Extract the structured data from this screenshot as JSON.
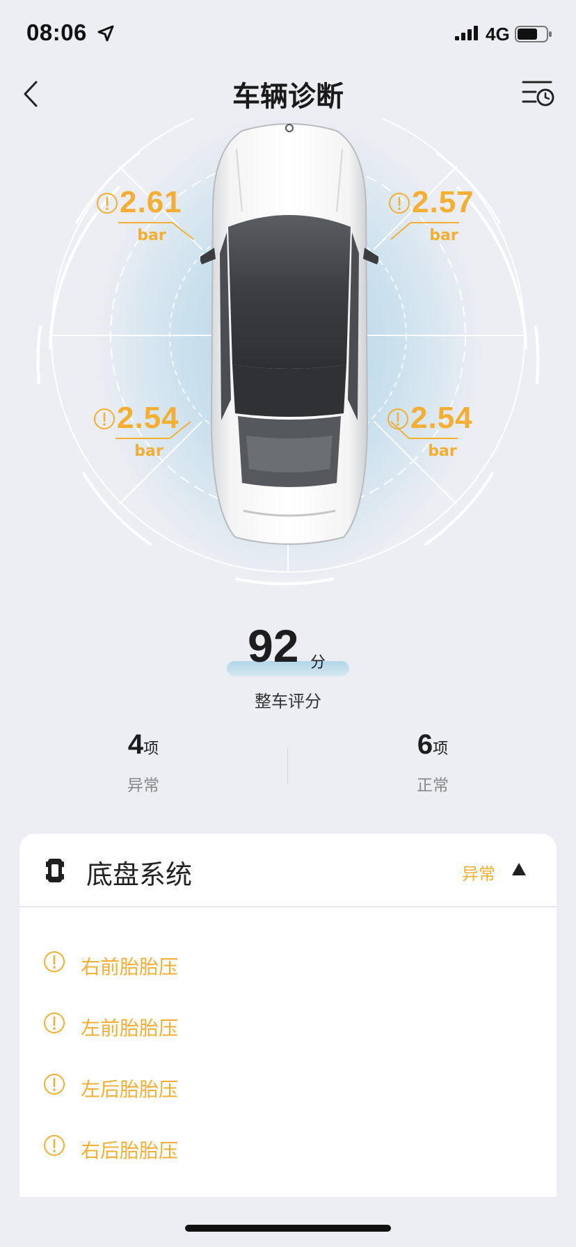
{
  "status_bar": {
    "time": "08:06",
    "network": "4G",
    "icons": [
      "location-arrow-icon",
      "signal-icon",
      "battery-icon"
    ]
  },
  "header": {
    "title": "车辆诊断",
    "icons": [
      "back-chevron-icon",
      "history-list-icon"
    ]
  },
  "tires": {
    "front_left": {
      "value": "2.61",
      "unit": "bar"
    },
    "front_right": {
      "value": "2.57",
      "unit": "bar"
    },
    "rear_left": {
      "value": "2.54",
      "unit": "bar"
    },
    "rear_right": {
      "value": "2.54",
      "unit": "bar"
    }
  },
  "score": {
    "value": "92",
    "unit": "分",
    "label": "整车评分"
  },
  "stats": {
    "abnormal": {
      "count": "4",
      "unit": "项",
      "label": "异常"
    },
    "normal": {
      "count": "6",
      "unit": "项",
      "label": "正常"
    }
  },
  "section": {
    "title": "底盘系统",
    "status": "异常",
    "icon": "chassis-icon",
    "items": [
      {
        "label": "右前胎胎压"
      },
      {
        "label": "左前胎胎压"
      },
      {
        "label": "左后胎胎压"
      },
      {
        "label": "右后胎胎压"
      }
    ]
  },
  "colors": {
    "accent_warning": "#f3ae33",
    "background": "#eceef3",
    "card": "#ffffff",
    "glow": "#a8d4ea"
  }
}
